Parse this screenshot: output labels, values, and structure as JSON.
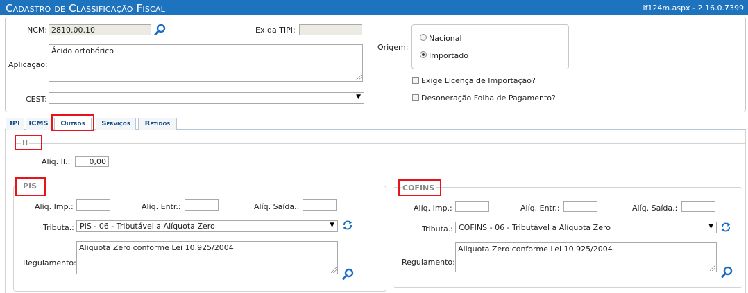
{
  "header": {
    "title": "Cadastro de Classificação Fiscal",
    "version": "lf124m.aspx - 2.16.0.7399"
  },
  "form": {
    "ncm_label": "NCM:",
    "ncm_value": "2810.00.10",
    "extipi_label": "Ex da TIPI:",
    "extipi_value": "",
    "aplicacao_label": "Aplicação:",
    "aplicacao_value": "Ácido ortobórico",
    "cest_label": "CEST:",
    "cest_value": "",
    "origem_label": "Origem:",
    "origem_options": [
      "Nacional",
      "Importado"
    ],
    "origem_selected": "Importado",
    "exige_licenca_label": "Exige Licença de Importação?",
    "desoneracao_label": "Desoneração Folha de Pagamento?"
  },
  "tabs": [
    "IPI",
    "ICMS",
    "Outros",
    "Serviços",
    "Retidos"
  ],
  "active_tab": "Outros",
  "ii": {
    "legend": "II",
    "aliq_label": "Alíq. II.:",
    "aliq_value": "0,00"
  },
  "pis": {
    "legend": "PIS",
    "aliq_imp_label": "Alíq. Imp.:",
    "aliq_entr_label": "Alíq. Entr.:",
    "aliq_saida_label": "Alíq. Saída.:",
    "tributa_label": "Tributa.:",
    "tributa_value": "PIS - 06 - Tributável a Alíquota Zero",
    "regulamento_label": "Regulamento:",
    "regulamento_value": "Aliquota Zero conforme Lei 10.925/2004"
  },
  "cofins": {
    "legend": "COFINS",
    "aliq_imp_label": "Alíq. Imp.:",
    "aliq_entr_label": "Alíq. Entr.:",
    "aliq_saida_label": "Alíq. Saída.:",
    "tributa_label": "Tributa.:",
    "tributa_value": "COFINS - 06 - Tributável a Alíquota Zero",
    "regulamento_label": "Regulamento:",
    "regulamento_value": "Aliquota Zero conforme Lei 10.925/2004"
  },
  "icons": {
    "search": "search-icon",
    "refresh": "refresh-icon",
    "dropdown": "chevron-down-icon"
  },
  "colors": {
    "header_bg": "#1e73be",
    "accent": "#1a6fc4",
    "highlight": "#e8141b"
  }
}
